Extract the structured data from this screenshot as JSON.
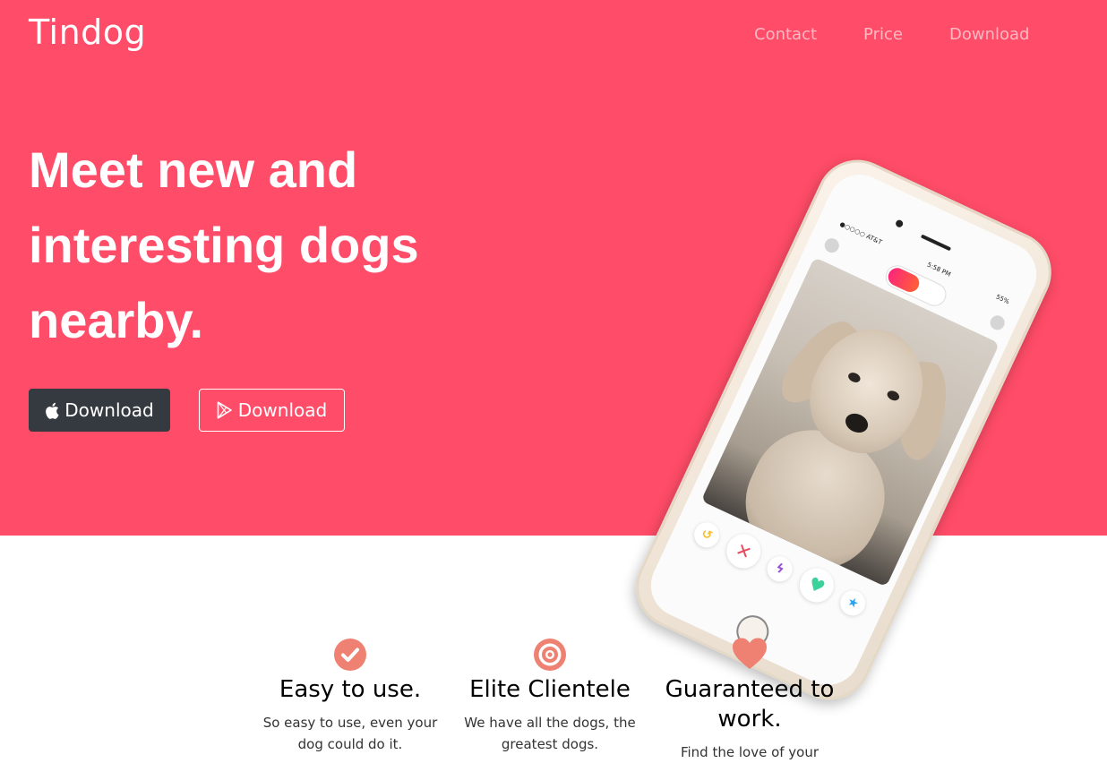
{
  "navbar": {
    "brand": "Tindog",
    "links": [
      "Contact",
      "Price",
      "Download"
    ]
  },
  "hero": {
    "headline": "Meet new and interesting dogs nearby.",
    "buttons": [
      {
        "label": "Download",
        "icon": "apple-icon"
      },
      {
        "label": "Download",
        "icon": "google-play-icon"
      }
    ],
    "phone": {
      "carrier": "●○○○○ AT&T",
      "time": "5:58 PM",
      "battery": "55%"
    }
  },
  "features": [
    {
      "icon": "check-circle-icon",
      "title": "Easy to use.",
      "text": "So easy to use, even your dog could do it."
    },
    {
      "icon": "bullseye-icon",
      "title": "Elite Clientele",
      "text": "We have all the dogs, the greatest dogs."
    },
    {
      "icon": "heart-icon",
      "title": "Guaranteed to work.",
      "text": "Find the love of your"
    }
  ],
  "colors": {
    "hero_bg": "#ff4c68",
    "feature_icon": "#ef8172",
    "dark_button": "#343a40"
  }
}
